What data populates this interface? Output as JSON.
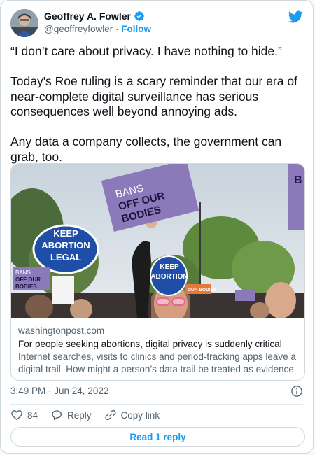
{
  "author": {
    "name": "Geoffrey A. Fowler",
    "handle": "@geoffreyfowler",
    "separator": "·",
    "follow_label": "Follow"
  },
  "tweet": {
    "paragraphs": [
      "“I don’t care about privacy. I have nothing to hide.”",
      "Today's Roe ruling is a scary reminder that our era of near-complete digital surveillance has serious consequences well beyond annoying ads.",
      "Any data a company collects, the government can grab, too."
    ]
  },
  "link_card": {
    "domain": "washingtonpost.com",
    "title": "For people seeking abortions, digital privacy is suddenly critical",
    "description": "Internet searches, visits to clinics and period-tracking apps leave a digital trail. How might a person’s data trail be treated as evidence ...",
    "photo_signs": {
      "main": [
        "BANS",
        "OFF OUR",
        "BODIES"
      ],
      "blue_oval": [
        "KEEP",
        "ABORTION",
        "LEGAL"
      ],
      "blue_oval_2": [
        "KEEP",
        "ABORTION"
      ],
      "small": [
        "BANS",
        "OFF OUR",
        "BODIES"
      ],
      "orange": "OUR BODIES",
      "right_edge": "B"
    }
  },
  "timestamp": "3:49 PM · Jun 24, 2022",
  "actions": {
    "likes": "84",
    "reply_label": "Reply",
    "copy_label": "Copy link"
  },
  "read_button": "Read 1 reply",
  "colors": {
    "accent": "#1d9bf0",
    "text": "#0f1419",
    "secondary": "#536471",
    "like": "#f91880"
  },
  "icons": [
    "verified-badge-icon",
    "twitter-bird-icon",
    "info-icon",
    "heart-icon",
    "reply-bubble-icon",
    "link-icon"
  ]
}
